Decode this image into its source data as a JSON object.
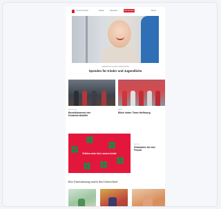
{
  "header": {
    "logo_text": "Kinderkrebshilfe",
    "nav": [
      "Helfen",
      "Spenden"
    ],
    "cta_label": "Jetzt spenden",
    "menu_label": "Menü"
  },
  "hero": {
    "kicker": "GEMEINSAM GEGEN KINDERKREBS",
    "title": "Spenden für Kinder und Jugendliche"
  },
  "news": [
    {
      "kicker": "AKTUELLES",
      "title": "Benefizkonzert der Kinderkrebshilfe"
    },
    {
      "kicker": "NEWS",
      "title": "Blick hinter Team Hoffnung"
    }
  ],
  "promo": {
    "banner_text": "Erfahre mehr über unsere Arbeit",
    "side_kicker": "AKTION",
    "side_title": "Glücksklee für eine Freude"
  },
  "section": {
    "title": "Ihre Unterstützung macht den Unterschied"
  },
  "colors": {
    "brand_red": "#d6202f",
    "promo_red": "#e3173c",
    "clover_green": "#1b8a4b"
  }
}
